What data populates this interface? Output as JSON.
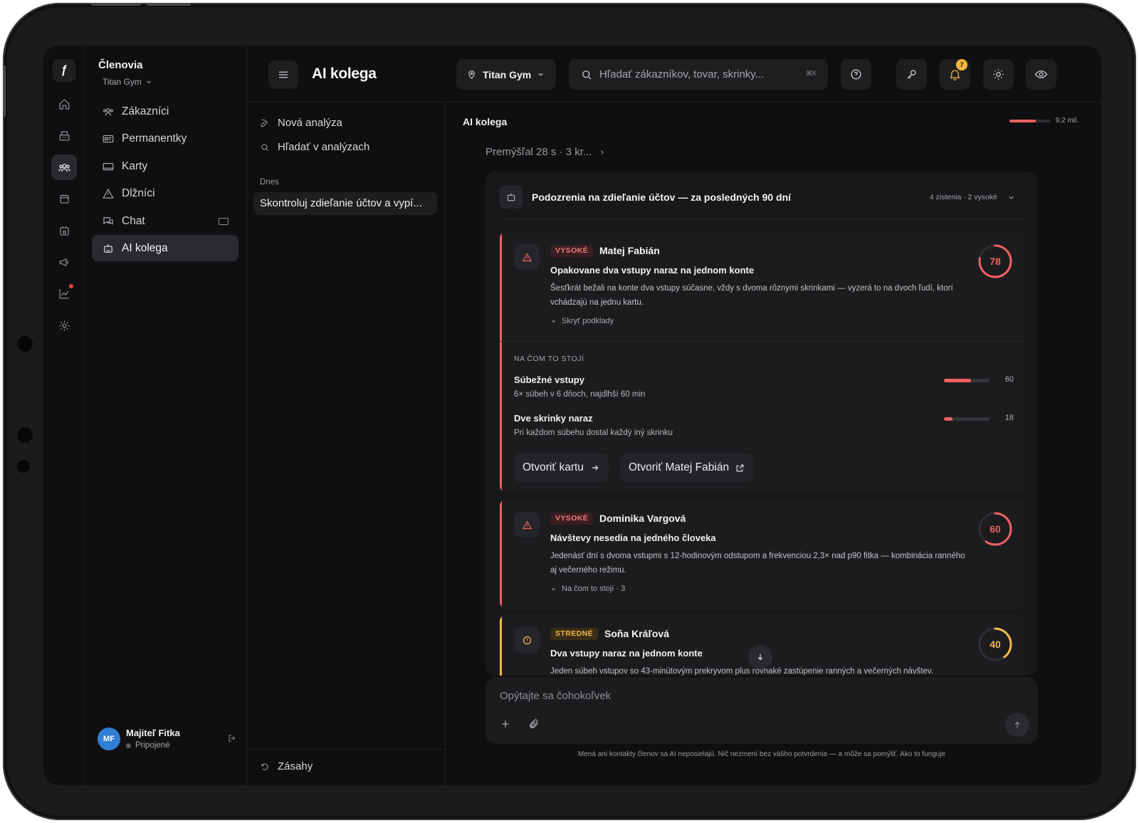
{
  "rail": {
    "items": [
      {
        "icon": "home-icon"
      },
      {
        "icon": "register-icon"
      },
      {
        "icon": "members-icon",
        "active": true
      },
      {
        "icon": "calendar-icon"
      },
      {
        "icon": "schedule-icon"
      },
      {
        "icon": "megaphone-icon"
      },
      {
        "icon": "chart-icon",
        "alert": true
      },
      {
        "icon": "settings-icon"
      }
    ]
  },
  "sidebar": {
    "title": "Členovia",
    "subtitle": "Titan Gym",
    "items": [
      {
        "label": "Zákazníci",
        "icon": "users-icon"
      },
      {
        "label": "Permanentky",
        "icon": "pass-icon"
      },
      {
        "label": "Karty",
        "icon": "card-icon"
      },
      {
        "label": "Dlžníci",
        "icon": "warning-icon"
      },
      {
        "label": "Chat",
        "icon": "chat-icon"
      },
      {
        "label": "AI kolega",
        "icon": "bot-icon",
        "active": true
      }
    ],
    "user": {
      "initials": "MF",
      "name": "Majiteľ Fitka",
      "status": "Pripojené"
    }
  },
  "header": {
    "title": "AI kolega",
    "gym": "Titan Gym",
    "search_placeholder": "Hľadať zákazníkov, tovar, skrinky...",
    "search_shortcut": "⌘K",
    "notifications": "7"
  },
  "history": {
    "new_analysis": "Nová analýza",
    "search_analyses": "Hľadať v analýzach",
    "group_today": "Dnes",
    "chat_title": "Skontroluj zdieľanie účtov a vypí...",
    "footer": "Zásahy"
  },
  "main": {
    "title": "AI kolega",
    "usage_label": "9,2 mil.",
    "usage_fraction": 0.66,
    "thought": "Premýšľal 28 s · 3 kr...",
    "panel": {
      "title": "Podozrenia na zdieľanie účtov — za posledných 90 dní",
      "meta": "4 zistenia · 2 vysoké"
    },
    "findings": [
      {
        "level": "VYSOKÉ",
        "name": "Matej Fabián",
        "headline": "Opakovane dva vstupy naraz na jednom konte",
        "description": "Šesťkrát bežali na konte dva vstupy súčasne, vždy s dvoma rôznymi skrinkami — vyzerá to na dvoch ľudí, ktorí vchádzajú na jednu kartu.",
        "score": 78,
        "score_color": "#f06161",
        "toggle": "Skryť podklady",
        "evidence_title": "NA ČOM TO STOJÍ",
        "evidence": [
          {
            "name": "Súbežné vstupy",
            "detail": "6× súbeh v 6 dňoch, najdlhší 60 min",
            "value": 60
          },
          {
            "name": "Dve skrinky naraz",
            "detail": "Pri každom súbehu dostal každý iný skrinku",
            "value": 18
          }
        ],
        "actions": [
          "Otvoriť kartu",
          "Otvoriť Matej Fabián"
        ]
      },
      {
        "level": "VYSOKÉ",
        "name": "Dominika Vargová",
        "headline": "Návštevy nesedia na jedného človeka",
        "description": "Jedenásť dní s dvoma vstupmi s 12-hodinovým odstupom a frekvenciou 2,3× nad p90 fitka — kombinácia ranného aj večerného režimu.",
        "score": 60,
        "score_color": "#f06161",
        "toggle": "Na čom to stojí · 3"
      },
      {
        "level": "STREDNÉ",
        "name": "Soňa Kráľová",
        "headline": "Dva vstupy naraz na jednom konte",
        "description": "Jeden súbeh vstupov so 43-minútovým prekryvom plus rovnaké zastúpenie ranných a večerných návštev.",
        "score": 40,
        "score_color": "#f3b94a"
      }
    ],
    "composer_placeholder": "Opýtajte sa čohokoľvek",
    "disclaimer": "Mená ani kontakty členov sa AI neposielajú. Nič nezmení bez vášho potvrdenia — a môže sa pomýliť. Ako to funguje"
  }
}
